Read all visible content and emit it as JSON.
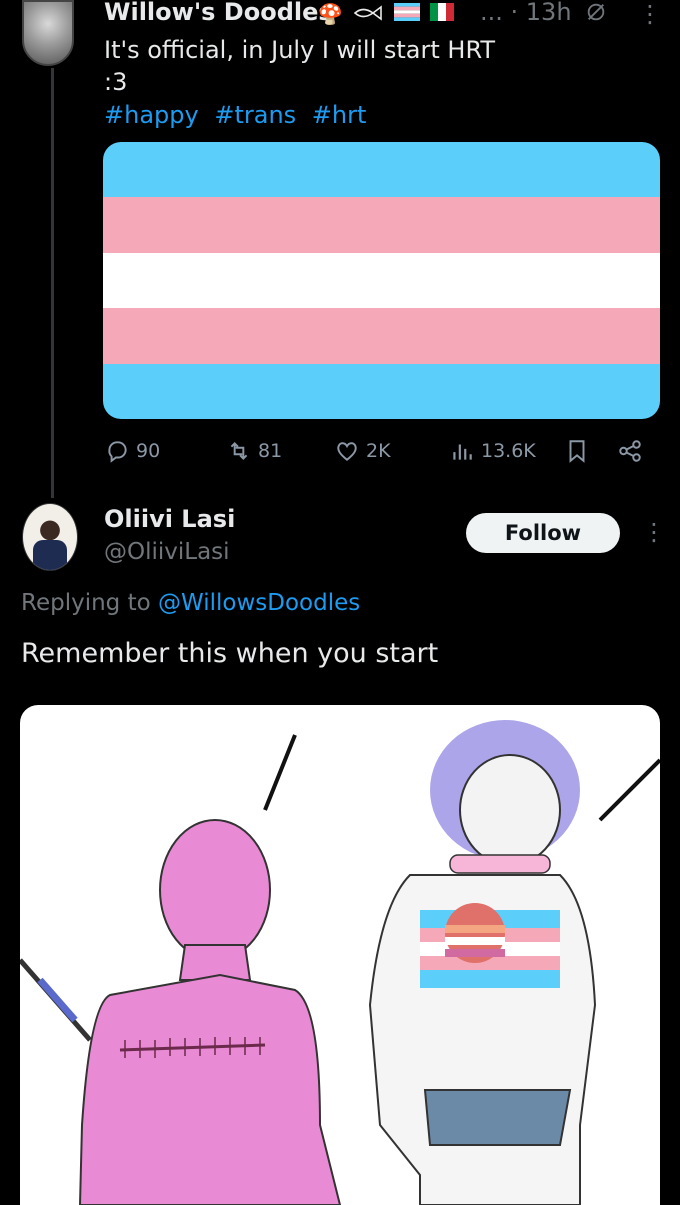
{
  "tweet": {
    "author_name": "Willow's Doodles",
    "badge_icons": [
      "mushroom",
      "fish",
      "trans-flag",
      "italy-flag"
    ],
    "ellipsis": "...",
    "time": "· 13h",
    "text": "It's official, in July I will start HRT\n:3",
    "hashtags": [
      "#happy",
      "#trans",
      "#hrt"
    ],
    "flag_colors": [
      "#5BCEFA",
      "#F5A9B8",
      "#FFFFFF",
      "#F5A9B8",
      "#5BCEFA"
    ],
    "actions": {
      "replies": "90",
      "reposts": "81",
      "likes": "2K",
      "views": "13.6K"
    }
  },
  "reply": {
    "author_name": "Oliivi Lasi",
    "handle": "@OliiviLasi",
    "follow_label": "Follow",
    "replying_prefix": "Replying to ",
    "replying_to": "@WillowsDoodles",
    "text": "Remember this when you start"
  },
  "colors": {
    "accent": "#1d9bf0",
    "muted": "#71767b",
    "background": "#000000"
  }
}
